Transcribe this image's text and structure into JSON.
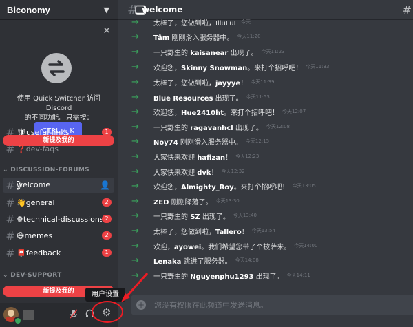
{
  "server": {
    "name": "Biconomy"
  },
  "popup": {
    "line1": "使用 Quick Switcher 访问 Discord",
    "line2": "的不同功能。只需按：",
    "button": "CTRL + K"
  },
  "sidebar": {
    "channels": [
      {
        "name": "🛡useful-links",
        "badge": "1"
      },
      {
        "name": "❓dev-faqs",
        "badge": ""
      }
    ],
    "mention_bar_top": "新提及我的",
    "category_forums": "DISCUSSION-FORUMS",
    "forum_channels": [
      {
        "name": "⃣welcome",
        "badge": ""
      },
      {
        "name": "👋general",
        "badge": "2"
      },
      {
        "name": "⚙technical-discussions",
        "badge": "2"
      },
      {
        "name": "😄memes",
        "badge": "2"
      },
      {
        "name": "📮feedback",
        "badge": "1"
      }
    ],
    "category_support": "DEV-SUPPORT",
    "mention_bar_bottom": "新提及我的"
  },
  "tooltip": "用户设置",
  "channel_header": {
    "name": "⃣welcome"
  },
  "messages": [
    {
      "pre": "太棒了，您做到啦，",
      "user": "",
      "post": "IlluLuL",
      "time": "今天"
    },
    {
      "pre": "",
      "user": "Tâm",
      "post": " 刚刚滑入服务器中。",
      "time": "今天11:20"
    },
    {
      "pre": "一只野生的 ",
      "user": "kaisanear",
      "post": " 出现了。",
      "time": "今天11:23"
    },
    {
      "pre": "欢迎您，",
      "user": "Skinny Snowman",
      "post": "。来打个招呼吧！",
      "time": "今天11:33"
    },
    {
      "pre": "太棒了，您做到啦，",
      "user": "jayyye",
      "post": "！",
      "time": "今天11:39"
    },
    {
      "pre": "",
      "user": "Blue Resources",
      "post": " 出现了。",
      "time": "今天11:53"
    },
    {
      "pre": "欢迎您，",
      "user": "Hue2410ht",
      "post": "。来打个招呼吧！",
      "time": "今天12:07"
    },
    {
      "pre": "一只野生的 ",
      "user": "ragavanhcl",
      "post": " 出现了。",
      "time": "今天12:08"
    },
    {
      "pre": "",
      "user": "Noy74",
      "post": " 刚刚滑入服务器中。",
      "time": "今天12:15"
    },
    {
      "pre": "大家快来欢迎 ",
      "user": "hafizan",
      "post": "！",
      "time": "今天12:23"
    },
    {
      "pre": "大家快来欢迎 ",
      "user": "dvk",
      "post": "！",
      "time": "今天12:32"
    },
    {
      "pre": "欢迎您，",
      "user": "Almighty_Roy",
      "post": "。来打个招呼吧！",
      "time": "今天13:05"
    },
    {
      "pre": "",
      "user": "ZED",
      "post": " 刚刚降落了。",
      "time": "今天13:30"
    },
    {
      "pre": "一只野生的 ",
      "user": "SZ",
      "post": " 出现了。",
      "time": "今天13:40"
    },
    {
      "pre": "太棒了，您做到啦，",
      "user": "Tallero",
      "post": "！",
      "time": "今天13:54"
    },
    {
      "pre": "欢迎，",
      "user": "ayowei",
      "post": "。我们希望您带了个披萨来。",
      "time": "今天14:00"
    },
    {
      "pre": "",
      "user": "Lenaka",
      "post": " 跳进了服务器。",
      "time": "今天14:08"
    },
    {
      "pre": "一只野生的 ",
      "user": "Nguyenphu1293",
      "post": " 出现了。",
      "time": "今天14:11"
    }
  ],
  "input": {
    "placeholder": "您没有权限在此频道中发送消息。"
  },
  "colors": {
    "accent": "#5865f2",
    "mention": "#ed4245",
    "online": "#3ba55d",
    "join_arrow": "#3ba55d"
  }
}
